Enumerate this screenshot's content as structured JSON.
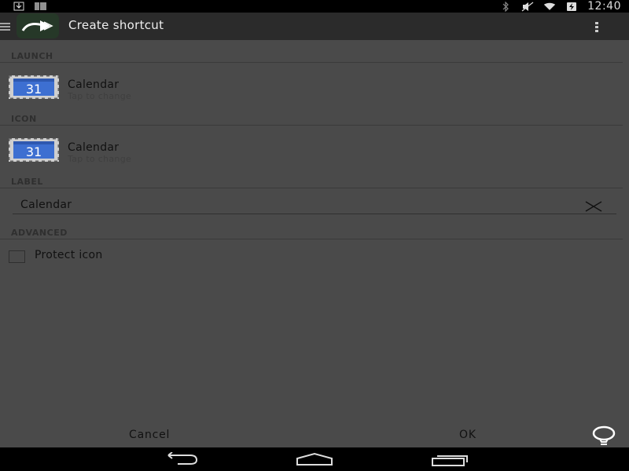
{
  "status_bar": {
    "left_icons": [
      "download-icon",
      "barcode-icon"
    ],
    "right_icons": [
      "bluetooth-icon",
      "mute-icon",
      "wifi-icon",
      "battery-charging-icon"
    ],
    "time": "12:40"
  },
  "action_bar": {
    "title": "Create shortcut",
    "menu_icon": "hamburger-icon",
    "logo_icon": "shortcut-arrow-icon",
    "overflow_icon": "overflow-menu-icon"
  },
  "sections": {
    "launch": {
      "header": "LAUNCH",
      "item": {
        "title": "Calendar",
        "subtitle": "Tap to change",
        "icon_text": "31"
      }
    },
    "icon": {
      "header": "ICON",
      "item": {
        "title": "Calendar",
        "subtitle": "Tap to change",
        "icon_text": "31"
      }
    },
    "label": {
      "header": "LABEL",
      "value": "Calendar"
    },
    "advanced": {
      "header": "ADVANCED",
      "protect_icon_label": "Protect icon",
      "protect_icon_checked": false
    }
  },
  "buttons": {
    "cancel": "Cancel",
    "ok": "OK"
  },
  "colors": {
    "background": "#4a4a4a",
    "action_bar": "#2b2b2b",
    "calendar_blue": "#3d6fd1"
  }
}
